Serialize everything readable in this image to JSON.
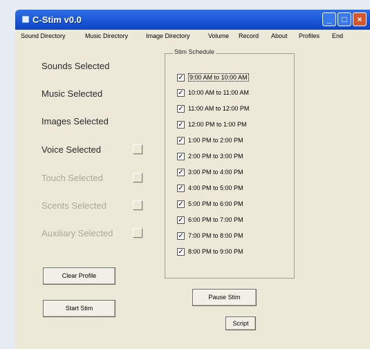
{
  "window": {
    "title": "C-Stim v0.0"
  },
  "menu": [
    "Sound Directory",
    "Music Directory",
    "Image Directory",
    "Volume",
    "Record",
    "About",
    "Profiles",
    "End"
  ],
  "labels": {
    "sounds": "Sounds Selected",
    "music": "Music Selected",
    "images": "Images Selected",
    "voice": "Voice Selected",
    "touch": "Touch Selected",
    "scents": "Scents Selected",
    "auxiliary": "Auxiliary Selected"
  },
  "schedule": {
    "title": "Stim Schedule",
    "items": [
      "9:00 AM to 10:00 AM",
      "10:00 AM to 11:00 AM",
      "11:00 AM to 12:00 PM",
      "12:00 PM to 1:00 PM",
      "1:00 PM to 2:00 PM",
      "2:00 PM to 3:00 PM",
      "3:00 PM to 4:00 PM",
      "4:00 PM to 5:00 PM",
      "5:00 PM to 6:00 PM",
      "6:00 PM to 7:00 PM",
      "7:00 PM to 8:00 PM",
      "8:00 PM to 9:00 PM"
    ],
    "checked": [
      true,
      true,
      true,
      true,
      true,
      true,
      true,
      true,
      true,
      true,
      true,
      true
    ]
  },
  "buttons": {
    "clear_profile": "Clear Profile",
    "start_stim": "Start Stim",
    "pause_stim": "Pause Stim",
    "script": "Script"
  }
}
